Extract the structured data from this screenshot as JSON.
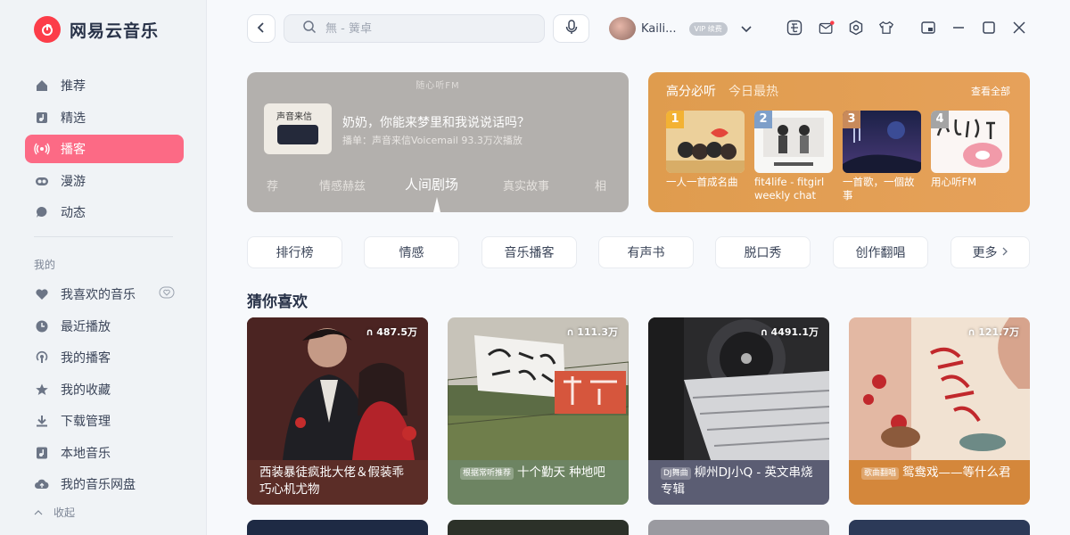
{
  "app": {
    "title": "网易云音乐"
  },
  "nav": [
    {
      "label": "推荐",
      "icon": "home-icon",
      "active": false
    },
    {
      "label": "精选",
      "icon": "music-note-icon",
      "active": false
    },
    {
      "label": "播客",
      "icon": "podcast-icon",
      "active": true
    },
    {
      "label": "漫游",
      "icon": "roam-icon",
      "active": false
    },
    {
      "label": "动态",
      "icon": "chat-icon",
      "active": false
    }
  ],
  "mine": {
    "section_label": "我的",
    "items": [
      {
        "label": "我喜欢的音乐",
        "icon": "heart-icon"
      },
      {
        "label": "最近播放",
        "icon": "clock-icon"
      },
      {
        "label": "我的播客",
        "icon": "podcast-icon"
      },
      {
        "label": "我的收藏",
        "icon": "star-icon"
      },
      {
        "label": "下载管理",
        "icon": "download-icon"
      },
      {
        "label": "本地音乐",
        "icon": "local-music-icon"
      },
      {
        "label": "我的音乐网盘",
        "icon": "cloud-icon"
      }
    ],
    "collapse_label": "收起"
  },
  "topbar": {
    "search_placeholder": "無 - 簧卓",
    "user_name": "Kaili...",
    "vip_label": "VIP 续费"
  },
  "fm": {
    "title": "随心听FM",
    "cover_label": "声音来信",
    "headline": "奶奶，你能来梦里和我说说话吗？",
    "meta": "播单：声音来信Voicemail  93.3万次播放",
    "tabs": [
      "荐",
      "情感赫兹",
      "人间剧场",
      "真实故事",
      "相"
    ]
  },
  "hot": {
    "title": "高分必听",
    "subtitle": "今日最热",
    "view_all": "查看全部",
    "items": [
      {
        "rank": "1",
        "name": "一人一首成名曲"
      },
      {
        "rank": "2",
        "name": "fit4life - fitgirl weekly chat"
      },
      {
        "rank": "3",
        "name": "一首歌，一個故事"
      },
      {
        "rank": "4",
        "name": "用心听FM"
      }
    ]
  },
  "categories": [
    "排行榜",
    "情感",
    "音乐播客",
    "有声书",
    "脱口秀",
    "创作翻唱",
    "更多"
  ],
  "guess": {
    "title": "猜你喜欢",
    "items": [
      {
        "count": "487.5万",
        "tag": "",
        "title": "西装暴徒疯批大佬＆假装乖巧心机尤物"
      },
      {
        "count": "111.3万",
        "tag": "根据常听推荐",
        "title": "十个勤天 种地吧"
      },
      {
        "count": "4491.1万",
        "tag": "DJ舞曲",
        "title": "柳州DJ小Q - 英文串烧专辑"
      },
      {
        "count": "121.7万",
        "tag": "歌曲翻唱",
        "title": "鸳鸯戏——等什么君"
      }
    ]
  },
  "colors": {
    "accent": "#fc3d49",
    "active_nav": "#fc6a85",
    "hot_card": "#df9c4e",
    "fm_card": "#b3b0ad"
  }
}
